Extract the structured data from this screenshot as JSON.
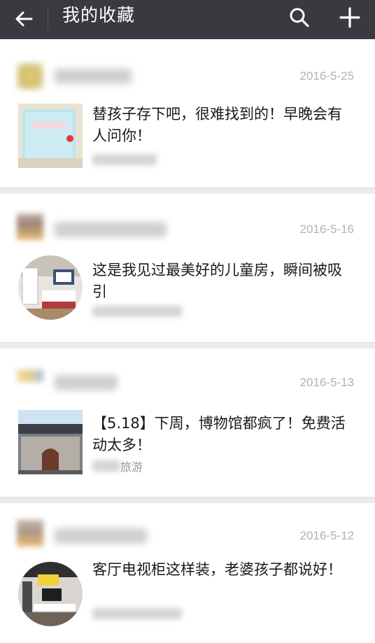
{
  "header": {
    "title": "我的收藏",
    "background": "#393a3f",
    "icons": [
      "back-arrow-icon",
      "search-icon",
      "plus-icon"
    ]
  },
  "items": [
    {
      "date": "2016-5-25",
      "title": "替孩子存下吧，很难找到的！早晚会有人问你！",
      "source": "",
      "thumb": "notebook-photo"
    },
    {
      "date": "2016-5-16",
      "title": "这是我见过最美好的儿童房，瞬间被吸引",
      "source": "",
      "thumb": "kids-room-photo"
    },
    {
      "date": "2016-5-13",
      "title": "【5.18】下周，博物馆都疯了！免费活动太多！",
      "source": "旅游",
      "thumb": "museum-photo"
    },
    {
      "date": "2016-5-12",
      "title": "客厅电视柜这样装，老婆孩子都说好！",
      "source": "",
      "thumb": "living-room-photo"
    }
  ]
}
